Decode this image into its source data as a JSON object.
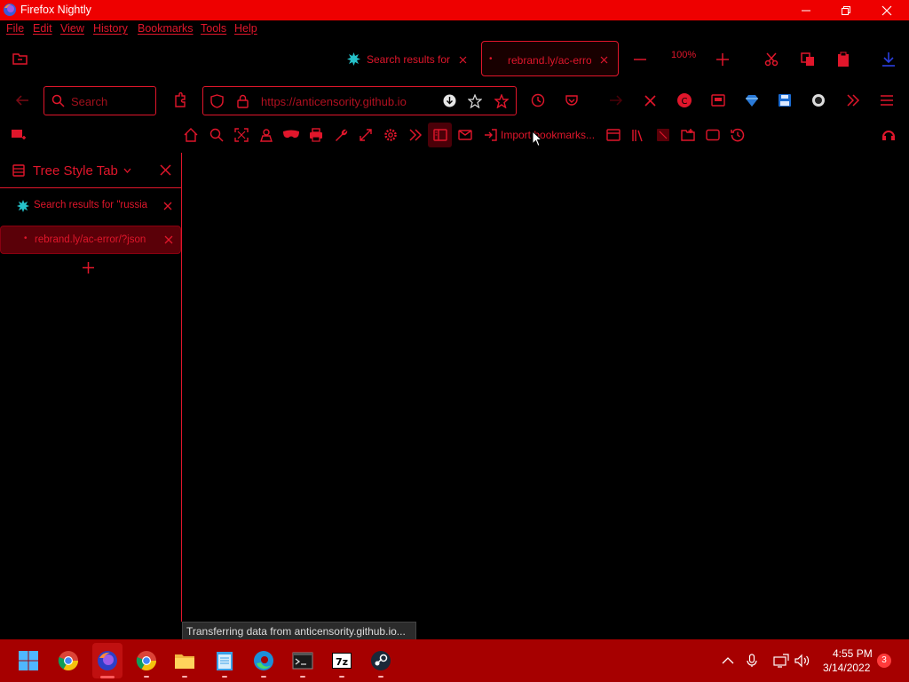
{
  "window": {
    "title": "Firefox Nightly"
  },
  "menu": [
    "File",
    "Edit",
    "View",
    "History",
    "Bookmarks",
    "Tools",
    "Help"
  ],
  "tabs": [
    {
      "label": "Search results for",
      "icon": "tor-logo-icon",
      "active": false
    },
    {
      "label": "rebrand.ly/ac-erro",
      "icon": "loading-dot-icon",
      "active": true
    }
  ],
  "zoom": "100%",
  "search": {
    "placeholder": "Search"
  },
  "urlbar": {
    "url": "https://anticensority.github.io"
  },
  "bookmarks": {
    "import_label": "Import bookmarks..."
  },
  "sidebar": {
    "title": "Tree Style Tab",
    "tabs": [
      {
        "label": "Search results for \"russia",
        "active": false
      },
      {
        "label": "rebrand.ly/ac-error/?json",
        "active": true
      }
    ]
  },
  "status": {
    "text": "Transferring data from anticensority.github.io..."
  },
  "taskbar": {
    "time": "4:55 PM",
    "date": "3/14/2022",
    "notification_count": "3"
  },
  "colors": {
    "accent": "#e0162b",
    "titlebar": "#ee0000",
    "taskbar": "#a60000",
    "background": "#000000"
  }
}
